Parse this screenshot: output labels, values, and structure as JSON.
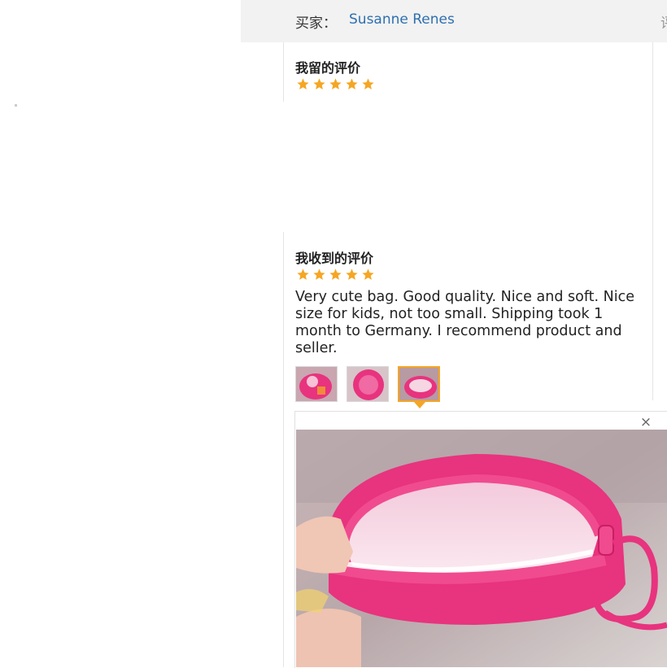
{
  "header": {
    "buyer_label": "买家：",
    "buyer_name": "Susanne Renes",
    "truncated_char": "评"
  },
  "my_review": {
    "title": "我留的评价",
    "rating": 5,
    "max_rating": 5
  },
  "received_review": {
    "title": "我收到的评价",
    "rating": 5,
    "max_rating": 5,
    "text": "Very cute bag. Good quality. Nice and soft. Nice size for kids, not too small. Shipping took 1 month to Germany. I recommend product and seller.",
    "thumbnails": [
      {
        "name": "thumbnail-1",
        "active": false
      },
      {
        "name": "thumbnail-2",
        "active": false
      },
      {
        "name": "thumbnail-3",
        "active": true
      }
    ]
  },
  "viewer": {
    "close_symbol": "×",
    "image_subject": "pink-zipper-bag-photo"
  },
  "colors": {
    "star": "#f5a623",
    "link": "#2e6fb0",
    "header_bg": "#f2f2f2",
    "bag_pink": "#e8337e"
  },
  "icons": {
    "star": "star-icon",
    "close": "close-icon",
    "pointer": "caret-down-icon"
  }
}
